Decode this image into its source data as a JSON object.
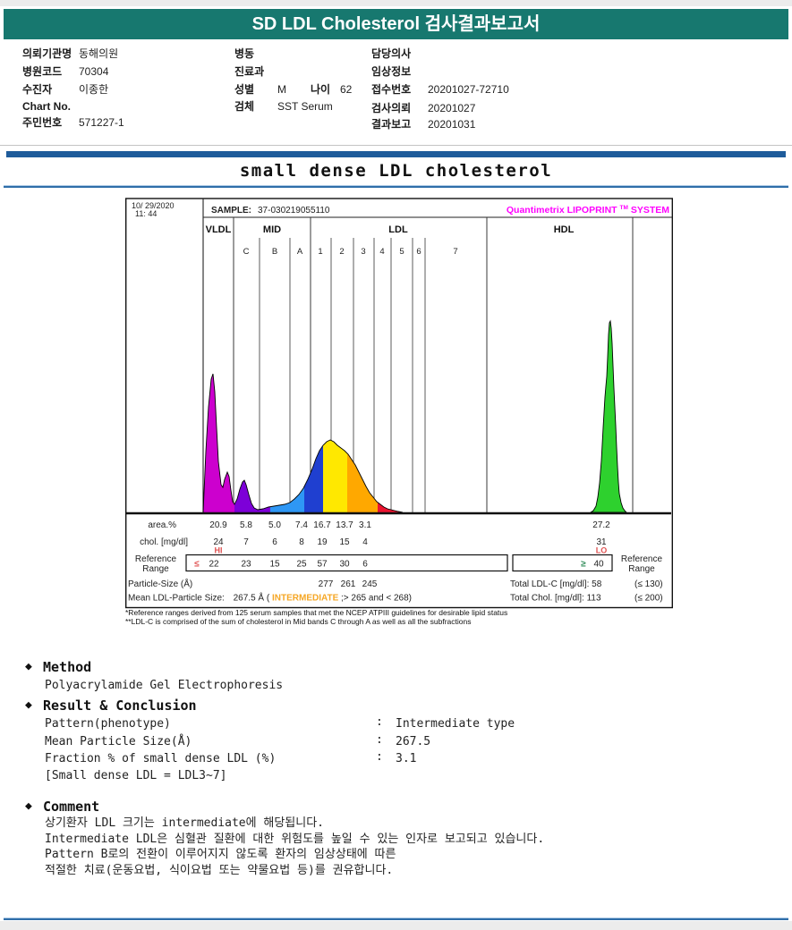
{
  "header": {
    "title": "SD LDL Cholesterol 검사결과보고서"
  },
  "patient": {
    "col1": [
      {
        "label": "의뢰기관명",
        "value": "동해의원"
      },
      {
        "label": "병원코드",
        "value": "70304"
      },
      {
        "label": "수진자",
        "value": "이종한"
      },
      {
        "label": "Chart No.",
        "value": ""
      },
      {
        "label": "주민번호",
        "value": "571227-1"
      }
    ],
    "col2": [
      {
        "label": "병동",
        "value": ""
      },
      {
        "label": "진료과",
        "value": ""
      },
      {
        "label": "성별",
        "value": "M",
        "label2": "나이",
        "value2": "62"
      },
      {
        "label": "검체",
        "value": "SST Serum"
      }
    ],
    "col3": [
      {
        "label": "담당의사",
        "value": ""
      },
      {
        "label": "임상정보",
        "value": ""
      },
      {
        "label": "접수번호",
        "value": "20201027-72710"
      },
      {
        "label": "검사의뢰",
        "value": "20201027"
      },
      {
        "label": "결과보고",
        "value": "20201031"
      }
    ]
  },
  "section_title": "small dense LDL cholesterol",
  "chart": {
    "date_line1": "10/ 29/2020",
    "date_line2": "11: 44",
    "sample_label": "SAMPLE:",
    "sample_value": "37-030219055110",
    "brand": {
      "part1": "Quantimetrix LIPOPRINT",
      "tm": "TM",
      "part2": "SYSTEM"
    },
    "groups": [
      "VLDL",
      "MID",
      "LDL",
      "HDL"
    ],
    "subbands": [
      "C",
      "B",
      "A",
      "1",
      "2",
      "3",
      "4",
      "5",
      "6",
      "7"
    ],
    "rows": {
      "area_label": "area.%",
      "chol_label": "chol. [mg/dl]",
      "ref_label1": "Reference",
      "ref_label2": "Range",
      "particle_label": "Particle-Size (Å)",
      "mean_label": "Mean LDL-Particle Size:",
      "mean_value": "267.5 Å (",
      "mean_flag": "INTERMEDIATE",
      "mean_range": ";> 265 and < 268)",
      "total_ldl_label": "Total LDL-C [mg/dl]: 58",
      "total_ldl_ref": "(≤ 130)",
      "total_chol_label": "Total Chol. [mg/dl]: 113",
      "total_chol_ref": "(≤ 200)",
      "hi_flag": "HI",
      "lo_flag": "LO",
      "ref_le": "≤",
      "ref_ge": "≥"
    },
    "values": {
      "area": [
        "20.9",
        "5.8",
        "5.0",
        "7.4",
        "16.7",
        "13.7",
        "3.1",
        "27.2"
      ],
      "chol": [
        "24",
        "7",
        "6",
        "8",
        "19",
        "15",
        "4",
        "31"
      ],
      "ref": [
        "22",
        "23",
        "15",
        "25",
        "57",
        "30",
        "6",
        "40"
      ],
      "particle": [
        "277",
        "261",
        "245"
      ]
    },
    "footnote1": "*Reference ranges derived from 125 serum samples that met the NCEP ATPIII guidelines for desirable lipid status",
    "footnote2": "**LDL-C is comprised of the sum of cholesterol in Mid bands C through A as well as all the subfractions"
  },
  "sections": {
    "method": {
      "heading": "Method",
      "body": "Polyacrylamide Gel Electrophoresis",
      "bullet": "◆"
    },
    "result": {
      "heading": "Result & Conclusion",
      "rows": [
        {
          "label": "Pattern(phenotype)",
          "colon": ":",
          "value": "Intermediate type"
        },
        {
          "label": "Mean Particle Size(Å)",
          "colon": ":",
          "value": "267.5"
        },
        {
          "label": "Fraction % of small dense LDL (%)",
          "colon": ":",
          "value": "3.1"
        }
      ],
      "note": "[Small dense LDL = LDL3~7]"
    },
    "comment": {
      "heading": "Comment",
      "lines": [
        "상기환자 LDL 크기는 intermediate에 해당됩니다.",
        "Intermediate LDL은 심혈관 질환에 대한 위험도를 높일 수 있는 인자로 보고되고 있습니다.",
        "Pattern B로의 전환이 이루어지지 않도록 환자의 임상상태에 따른",
        "적절한 치료(운동요법, 식이요법 또는 약물요법 등)를 권유합니다."
      ]
    }
  },
  "colors": {
    "header_teal": "#17786f",
    "separator_blue": "#1f5c9b",
    "brand_magenta": "#ff00ff",
    "flag_red": "#e05252",
    "flag_orange": "#f5a623",
    "ge_green": "#2e8b57",
    "vldl": "#cc00ce",
    "mid_c": "#7d00d8",
    "mid_b": "#2e97f5",
    "mid_a": "#1f3fd0",
    "ldl1": "#ffe800",
    "ldl2": "#ffa800",
    "ldl3": "#ec1430",
    "hdl": "#2ed12e"
  },
  "chart_data": {
    "type": "area",
    "title": "small dense LDL cholesterol",
    "subtitle": "Quantimetrix LIPOPRINT SYSTEM densitometry scan",
    "x_bands": [
      "VLDL",
      "MID C",
      "MID B",
      "MID A",
      "LDL 1",
      "LDL 2",
      "LDL 3",
      "LDL 4",
      "LDL 5",
      "LDL 6",
      "LDL 7",
      "HDL"
    ],
    "series": [
      {
        "name": "area %",
        "values": [
          20.9,
          5.8,
          5.0,
          7.4,
          16.7,
          13.7,
          3.1,
          null,
          null,
          null,
          null,
          27.2
        ]
      },
      {
        "name": "chol. [mg/dl]",
        "values": [
          24,
          7,
          6,
          8,
          19,
          15,
          4,
          null,
          null,
          null,
          null,
          31
        ]
      },
      {
        "name": "reference range",
        "values": [
          "≤ 22",
          "23",
          "15",
          "25",
          "57",
          "30",
          "6",
          null,
          null,
          null,
          null,
          "≥ 40"
        ]
      },
      {
        "name": "particle size (Å)",
        "values": [
          null,
          null,
          null,
          null,
          277,
          261,
          245,
          null,
          null,
          null,
          null,
          null
        ]
      }
    ],
    "annotations": {
      "vldl_flag": "HI",
      "hdl_flag": "LO",
      "mean_ldl_particle_size_A": 267.5,
      "mean_ldl_pattern": "INTERMEDIATE (> 265 and < 268)",
      "total_ldl_c_mg_dl": 58,
      "total_ldl_c_ref": "≤ 130",
      "total_chol_mg_dl": 113,
      "total_chol_ref": "≤ 200"
    },
    "grid": "vertical lane separators",
    "legend_position": "none"
  }
}
